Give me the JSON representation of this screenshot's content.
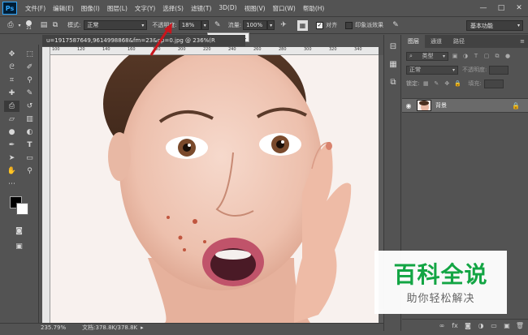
{
  "app": {
    "logo": "Ps"
  },
  "menu": [
    "文件(F)",
    "编辑(E)",
    "图像(I)",
    "图层(L)",
    "文字(Y)",
    "选择(S)",
    "滤镜(T)",
    "3D(D)",
    "视图(V)",
    "窗口(W)",
    "帮助(H)"
  ],
  "window_controls": {
    "minimize": "—",
    "maximize": "□",
    "close": "✕"
  },
  "options": {
    "brush_size": "21",
    "mode_label": "模式:",
    "mode_value": "正常",
    "opacity_label": "不透明度:",
    "opacity_value": "18%",
    "flow_label": "流量:",
    "flow_value": "100%",
    "align_label": "对齐",
    "align_checked": true,
    "sample_label": "印象派效果",
    "workspace": "基本功能"
  },
  "document": {
    "tab_title": "u=1917587649,9614998868&fm=23&gp=0.jpg @ 236%(R",
    "zoom": "235.79%",
    "doc_info": "文档:378.8K/378.8K"
  },
  "ruler_marks": [
    "100",
    "120",
    "140",
    "160",
    "180",
    "200",
    "220",
    "240",
    "260",
    "280",
    "300",
    "320",
    "340"
  ],
  "panels": {
    "tabs": [
      "图层",
      "通道",
      "路径"
    ],
    "filter_kind": "类型",
    "blend_mode": "正常",
    "opacity_label": "不透明度:",
    "lock_label": "锁定:",
    "fill_label": "填充:",
    "layer_name": "背景"
  },
  "watermark": {
    "title": "百科全说",
    "subtitle": "助你轻松解决"
  },
  "colors": {
    "ui_bg": "#535353",
    "accent": "#31a8ff",
    "watermark_green": "#11a844",
    "arrow": "#c8161d"
  }
}
